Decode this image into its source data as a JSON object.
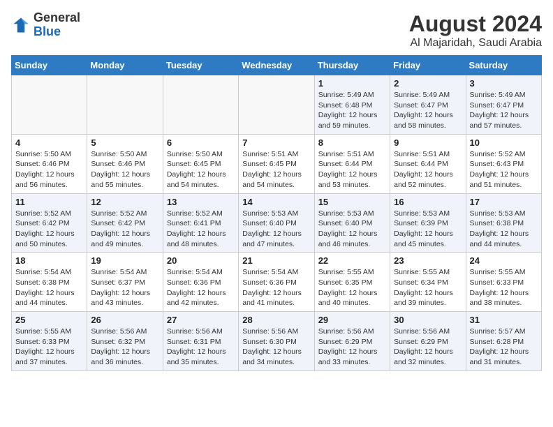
{
  "header": {
    "logo_general": "General",
    "logo_blue": "Blue",
    "month_year": "August 2024",
    "location": "Al Majaridah, Saudi Arabia"
  },
  "days_of_week": [
    "Sunday",
    "Monday",
    "Tuesday",
    "Wednesday",
    "Thursday",
    "Friday",
    "Saturday"
  ],
  "weeks": [
    [
      {
        "day": "",
        "info": ""
      },
      {
        "day": "",
        "info": ""
      },
      {
        "day": "",
        "info": ""
      },
      {
        "day": "",
        "info": ""
      },
      {
        "day": "1",
        "info": "Sunrise: 5:49 AM\nSunset: 6:48 PM\nDaylight: 12 hours\nand 59 minutes."
      },
      {
        "day": "2",
        "info": "Sunrise: 5:49 AM\nSunset: 6:47 PM\nDaylight: 12 hours\nand 58 minutes."
      },
      {
        "day": "3",
        "info": "Sunrise: 5:49 AM\nSunset: 6:47 PM\nDaylight: 12 hours\nand 57 minutes."
      }
    ],
    [
      {
        "day": "4",
        "info": "Sunrise: 5:50 AM\nSunset: 6:46 PM\nDaylight: 12 hours\nand 56 minutes."
      },
      {
        "day": "5",
        "info": "Sunrise: 5:50 AM\nSunset: 6:46 PM\nDaylight: 12 hours\nand 55 minutes."
      },
      {
        "day": "6",
        "info": "Sunrise: 5:50 AM\nSunset: 6:45 PM\nDaylight: 12 hours\nand 54 minutes."
      },
      {
        "day": "7",
        "info": "Sunrise: 5:51 AM\nSunset: 6:45 PM\nDaylight: 12 hours\nand 54 minutes."
      },
      {
        "day": "8",
        "info": "Sunrise: 5:51 AM\nSunset: 6:44 PM\nDaylight: 12 hours\nand 53 minutes."
      },
      {
        "day": "9",
        "info": "Sunrise: 5:51 AM\nSunset: 6:44 PM\nDaylight: 12 hours\nand 52 minutes."
      },
      {
        "day": "10",
        "info": "Sunrise: 5:52 AM\nSunset: 6:43 PM\nDaylight: 12 hours\nand 51 minutes."
      }
    ],
    [
      {
        "day": "11",
        "info": "Sunrise: 5:52 AM\nSunset: 6:42 PM\nDaylight: 12 hours\nand 50 minutes."
      },
      {
        "day": "12",
        "info": "Sunrise: 5:52 AM\nSunset: 6:42 PM\nDaylight: 12 hours\nand 49 minutes."
      },
      {
        "day": "13",
        "info": "Sunrise: 5:52 AM\nSunset: 6:41 PM\nDaylight: 12 hours\nand 48 minutes."
      },
      {
        "day": "14",
        "info": "Sunrise: 5:53 AM\nSunset: 6:40 PM\nDaylight: 12 hours\nand 47 minutes."
      },
      {
        "day": "15",
        "info": "Sunrise: 5:53 AM\nSunset: 6:40 PM\nDaylight: 12 hours\nand 46 minutes."
      },
      {
        "day": "16",
        "info": "Sunrise: 5:53 AM\nSunset: 6:39 PM\nDaylight: 12 hours\nand 45 minutes."
      },
      {
        "day": "17",
        "info": "Sunrise: 5:53 AM\nSunset: 6:38 PM\nDaylight: 12 hours\nand 44 minutes."
      }
    ],
    [
      {
        "day": "18",
        "info": "Sunrise: 5:54 AM\nSunset: 6:38 PM\nDaylight: 12 hours\nand 44 minutes."
      },
      {
        "day": "19",
        "info": "Sunrise: 5:54 AM\nSunset: 6:37 PM\nDaylight: 12 hours\nand 43 minutes."
      },
      {
        "day": "20",
        "info": "Sunrise: 5:54 AM\nSunset: 6:36 PM\nDaylight: 12 hours\nand 42 minutes."
      },
      {
        "day": "21",
        "info": "Sunrise: 5:54 AM\nSunset: 6:36 PM\nDaylight: 12 hours\nand 41 minutes."
      },
      {
        "day": "22",
        "info": "Sunrise: 5:55 AM\nSunset: 6:35 PM\nDaylight: 12 hours\nand 40 minutes."
      },
      {
        "day": "23",
        "info": "Sunrise: 5:55 AM\nSunset: 6:34 PM\nDaylight: 12 hours\nand 39 minutes."
      },
      {
        "day": "24",
        "info": "Sunrise: 5:55 AM\nSunset: 6:33 PM\nDaylight: 12 hours\nand 38 minutes."
      }
    ],
    [
      {
        "day": "25",
        "info": "Sunrise: 5:55 AM\nSunset: 6:33 PM\nDaylight: 12 hours\nand 37 minutes."
      },
      {
        "day": "26",
        "info": "Sunrise: 5:56 AM\nSunset: 6:32 PM\nDaylight: 12 hours\nand 36 minutes."
      },
      {
        "day": "27",
        "info": "Sunrise: 5:56 AM\nSunset: 6:31 PM\nDaylight: 12 hours\nand 35 minutes."
      },
      {
        "day": "28",
        "info": "Sunrise: 5:56 AM\nSunset: 6:30 PM\nDaylight: 12 hours\nand 34 minutes."
      },
      {
        "day": "29",
        "info": "Sunrise: 5:56 AM\nSunset: 6:29 PM\nDaylight: 12 hours\nand 33 minutes."
      },
      {
        "day": "30",
        "info": "Sunrise: 5:56 AM\nSunset: 6:29 PM\nDaylight: 12 hours\nand 32 minutes."
      },
      {
        "day": "31",
        "info": "Sunrise: 5:57 AM\nSunset: 6:28 PM\nDaylight: 12 hours\nand 31 minutes."
      }
    ]
  ]
}
